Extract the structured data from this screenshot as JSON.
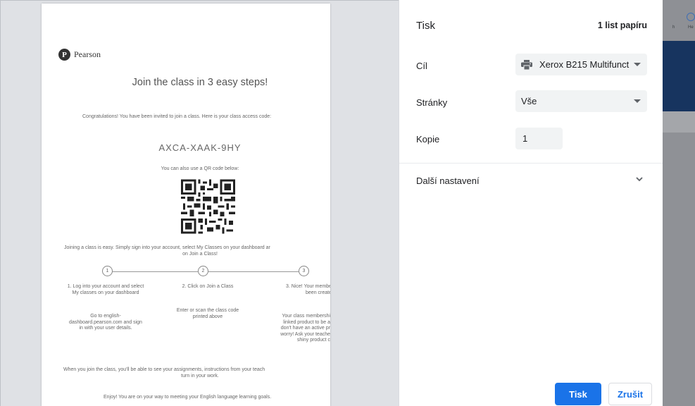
{
  "document": {
    "logo_text": "Pearson",
    "title": "Join the class in 3 easy steps!",
    "congrats": "Congratulations! You have been invited to join a class. Here is your class access code:",
    "access_code": "AXCA-XAAK-9HY",
    "qr_caption": "You can also use a QR code below:",
    "joining_line1": "Joining a class is easy. Simply sign into your account, select My Classes on your dashboard ar",
    "joining_line2": "on Join a Class!",
    "steps": [
      {
        "number": "1",
        "title_line1": "1. Log into your account and select",
        "title_line2": "My classes on your dashboard",
        "desc": [
          "Go to english-",
          "dashboard.pearson.com and sign",
          "in with your user details."
        ]
      },
      {
        "number": "2",
        "title_line1": "2. Click on Join a Class",
        "title_line2": "",
        "desc": [
          "Enter or scan the class code",
          "printed above"
        ]
      },
      {
        "number": "3",
        "title_line1": "3. Nice! Your membe",
        "title_line2": "been create",
        "desc": [
          "Your class membershi",
          "linked product to be a",
          "don't have an active pr",
          "worry! Ask your teache",
          "shiny product c"
        ]
      }
    ],
    "footer_line1": "When you join the class, you'll be able to see your assignments, instructions from your teach",
    "footer_line2": "turn in your work.",
    "closing": "Enjoy! You are on your way to meeting your English language learning goals."
  },
  "print_panel": {
    "title": "Tisk",
    "sheet_count": "1 list papíru",
    "destination_label": "Cíl",
    "destination_value": "Xerox B215 Multifunct",
    "pages_label": "Stránky",
    "pages_value": "Vše",
    "copies_label": "Kopie",
    "copies_value": "1",
    "more_settings_label": "Další nastavení",
    "print_button": "Tisk",
    "cancel_button": "Zrušit"
  },
  "background": {
    "header_fragment_1": "h",
    "header_fragment_2": "He"
  },
  "colors": {
    "accent": "#1a73e8",
    "preview_bg": "#dfe1e5",
    "field_bg": "#f1f3f4",
    "page_header_blue": "#17345f"
  }
}
